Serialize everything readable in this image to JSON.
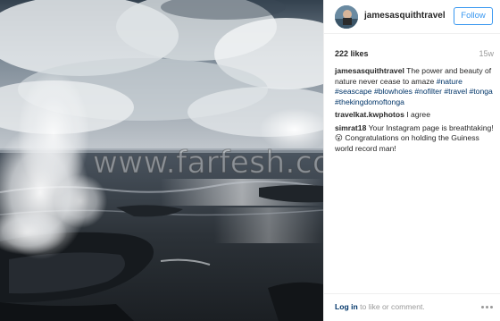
{
  "post": {
    "username": "jamesasquithtravel",
    "follow_label": "Follow",
    "likes": "222 likes",
    "age": "15w",
    "caption": {
      "username": "jamesasquithtravel",
      "text": " The power and beauty of nature never cease to amaze ",
      "hashtags": [
        "#nature",
        "#seascape",
        "#blowholes",
        "#nofilter",
        "#travel",
        "#tonga",
        "#thekingdomoftonga"
      ]
    },
    "comments": [
      {
        "username": "travelkat.kwphotos",
        "text": " I agree"
      },
      {
        "username": "simrat18",
        "text": " Your Instagram page is breathtaking! 😮 Congratulations on holding the Guiness world record man!"
      }
    ],
    "footer": {
      "login_label": "Log in",
      "login_suffix": " to like or comment."
    }
  },
  "watermark": "www.farfesh.com",
  "icons": {
    "more": "more-options-icon",
    "avatar": "profile-avatar"
  },
  "colors": {
    "link": "#003569",
    "follow_accent": "#3897f0",
    "muted": "#999999"
  }
}
